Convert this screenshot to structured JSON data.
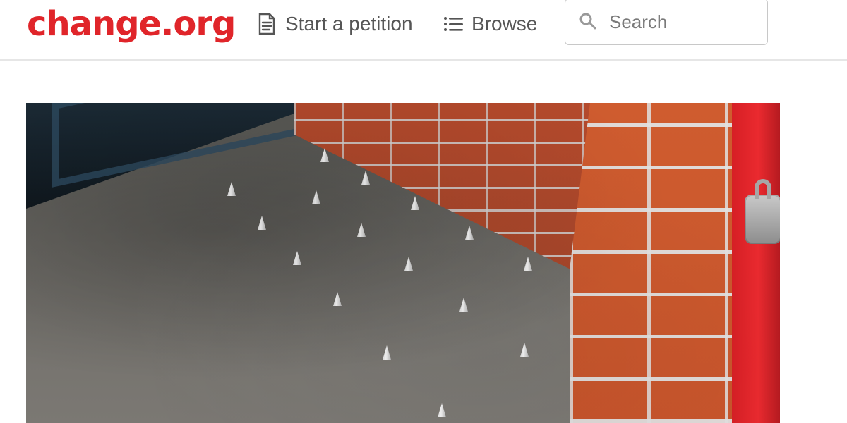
{
  "header": {
    "logo_text": "change.org",
    "nav": {
      "start_petition": "Start a petition",
      "browse": "Browse"
    },
    "search": {
      "placeholder": "Search"
    }
  },
  "icons": {
    "start_petition": "document-icon",
    "browse": "list-icon",
    "search": "search-icon",
    "lock": "padlock-icon"
  },
  "colors": {
    "brand_red": "#e0252a",
    "nav_text": "#555555",
    "border": "#e6e6e6"
  }
}
